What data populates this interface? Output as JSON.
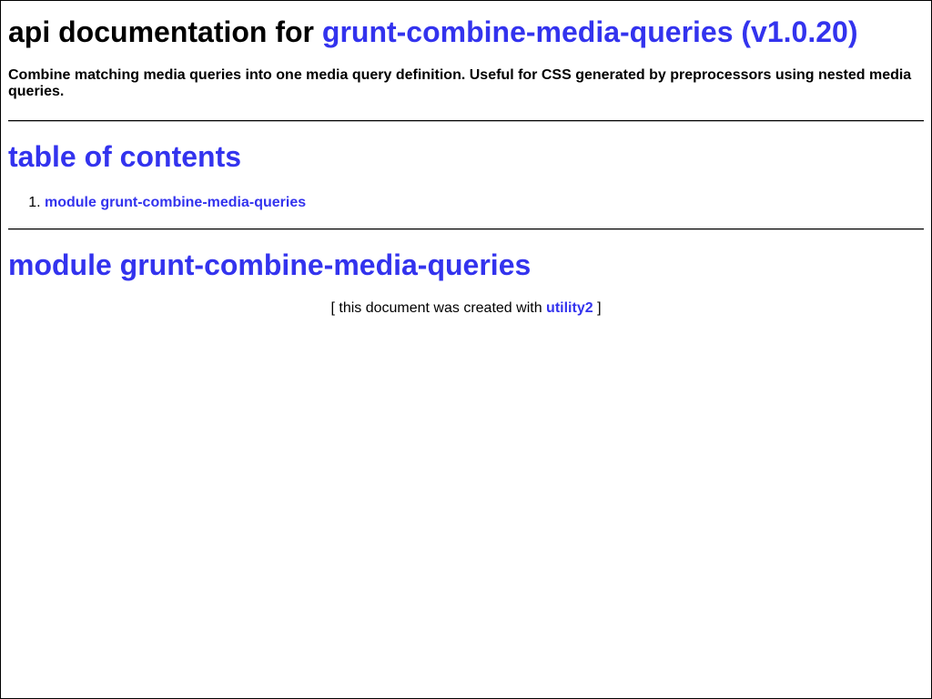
{
  "header": {
    "title_prefix": "api documentation for",
    "title_link": "grunt-combine-media-queries (v1.0.20)"
  },
  "description": "Combine matching media queries into one media query definition. Useful for CSS generated by preprocessors using nested media queries.",
  "toc": {
    "heading": "table of contents",
    "items": [
      {
        "number": "1.",
        "label": "module grunt-combine-media-queries"
      }
    ]
  },
  "module": {
    "heading": "module grunt-combine-media-queries"
  },
  "footer": {
    "prefix": "[ this document was created with",
    "link": "utility2",
    "suffix": "]"
  },
  "colors": {
    "link": "#3333ee",
    "text": "#000000",
    "background": "#ffffff"
  }
}
